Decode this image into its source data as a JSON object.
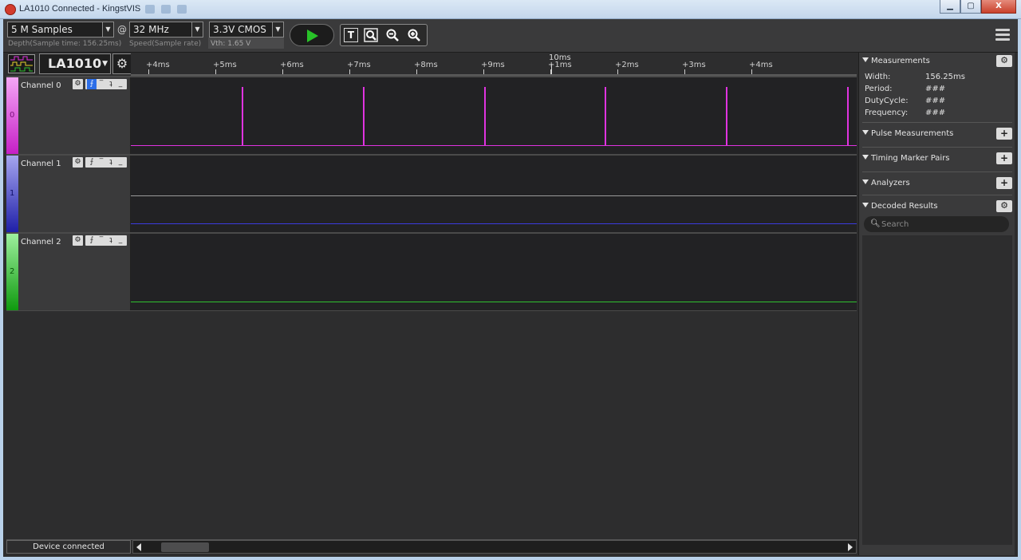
{
  "window": {
    "title": "LA1010 Connected - KingstVIS",
    "min_label": "▁",
    "max_label": "▢",
    "close_label": "X"
  },
  "toolbar": {
    "depth_value": "5 M Samples",
    "depth_caption": "Depth(Sample time: 156.25ms)",
    "at_sign": "@",
    "speed_value": "32 MHz",
    "speed_caption": "Speed(Sample rate)",
    "vth_value": "3.3V CMOS",
    "vth_caption": "Vth: 1.65 V",
    "zoom_t_label": "T"
  },
  "device": {
    "name": "LA1010"
  },
  "timeline": {
    "major_label": "10ms",
    "ticks": [
      "+4ms",
      "+5ms",
      "+6ms",
      "+7ms",
      "+8ms",
      "+9ms",
      "+1ms",
      "+2ms",
      "+3ms",
      "+4ms"
    ]
  },
  "channels": [
    {
      "name": "Channel 0",
      "index": "0",
      "color": "#e033e0",
      "pulse_count": 6
    },
    {
      "name": "Channel 1",
      "index": "1",
      "color": "#3b3bdf"
    },
    {
      "name": "Channel 2",
      "index": "2",
      "color": "#2fc02f"
    }
  ],
  "status": {
    "text": "Device connected"
  },
  "panel": {
    "measurements": {
      "title": "Measurements",
      "rows": [
        {
          "label": "Width:",
          "value": "156.25ms"
        },
        {
          "label": "Period:",
          "value": "###"
        },
        {
          "label": "DutyCycle:",
          "value": "###"
        },
        {
          "label": "Frequency:",
          "value": "###"
        }
      ]
    },
    "pulse_title": "Pulse Measurements",
    "timing_title": "Timing Marker Pairs",
    "analyzers_title": "Analyzers",
    "decoded_title": "Decoded Results",
    "search_placeholder": "Search"
  }
}
